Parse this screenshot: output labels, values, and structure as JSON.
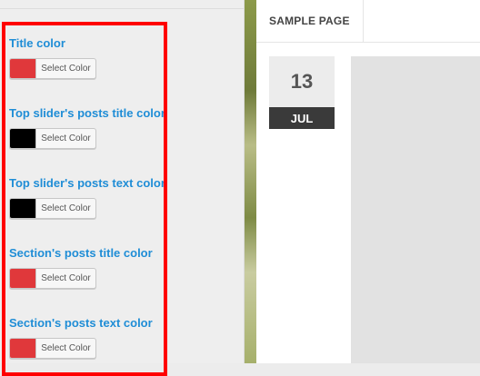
{
  "customizer": {
    "controls": [
      {
        "label": "Title color",
        "button": "Select Color",
        "swatch": "#e0383b"
      },
      {
        "label": "Top slider's posts title color",
        "button": "Select Color",
        "swatch": "#000000"
      },
      {
        "label": "Top slider's posts text color",
        "button": "Select Color",
        "swatch": "#000000"
      },
      {
        "label": "Section's posts title color",
        "button": "Select Color",
        "swatch": "#e0383b"
      },
      {
        "label": "Section's posts text color",
        "button": "Select Color",
        "swatch": "#e0383b"
      }
    ]
  },
  "preview": {
    "nav": {
      "item": "SAMPLE PAGE"
    },
    "post_date": {
      "day": "13",
      "month": "JUL"
    }
  },
  "colors": {
    "label_blue": "#1f8dd6",
    "highlight_red": "#ff0000"
  }
}
